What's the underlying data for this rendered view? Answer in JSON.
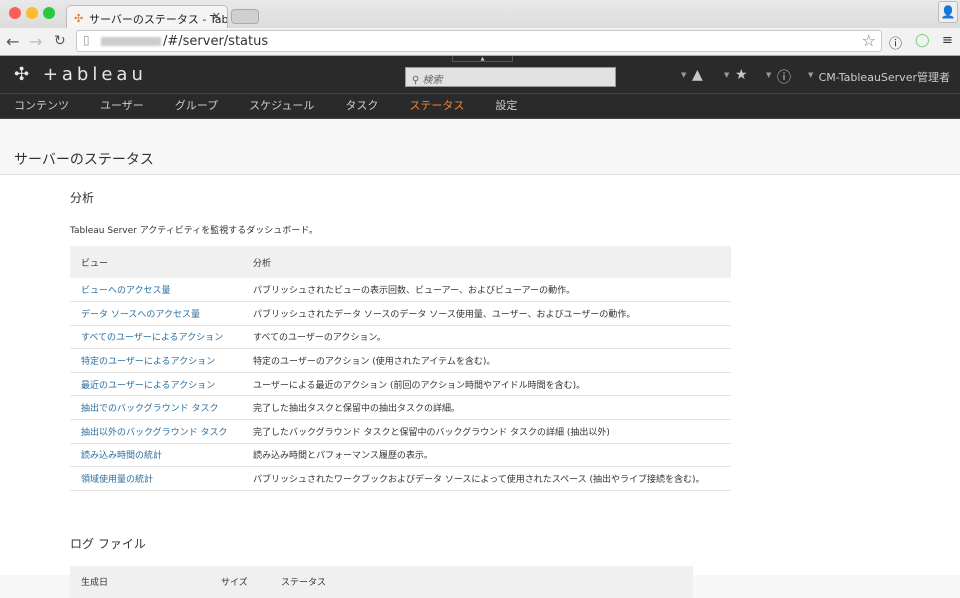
{
  "browser": {
    "tab_title": "サーバーのステータス - Tableau",
    "url_suffix": "/#/server/status"
  },
  "header": {
    "logo": "+ableau",
    "search_placeholder": "検索",
    "user": "CM-TableauServer管理者"
  },
  "nav": [
    "コンテンツ",
    "ユーザー",
    "グループ",
    "スケジュール",
    "タスク",
    "ステータス",
    "設定"
  ],
  "nav_active": 5,
  "page_title": "サーバーのステータス",
  "analysis": {
    "title": "分析",
    "description": "Tableau Server アクティビティを監視するダッシュボード。",
    "columns": [
      "ビュー",
      "分析"
    ],
    "rows": [
      [
        "ビューへのアクセス量",
        "パブリッシュされたビューの表示回数、ビューアー、およびビューアーの動作。"
      ],
      [
        "データ ソースへのアクセス量",
        "パブリッシュされたデータ ソースのデータ ソース使用量、ユーザー、およびユーザーの動作。"
      ],
      [
        "すべてのユーザーによるアクション",
        "すべてのユーザーのアクション。"
      ],
      [
        "特定のユーザーによるアクション",
        "特定のユーザーのアクション (使用されたアイテムを含む)。"
      ],
      [
        "最近のユーザーによるアクション",
        "ユーザーによる最近のアクション (前回のアクション時間やアイドル時間を含む)。"
      ],
      [
        "抽出でのバックグラウンド タスク",
        "完了した抽出タスクと保留中の抽出タスクの詳細。"
      ],
      [
        "抽出以外のバックグラウンド タスク",
        "完了したバックグラウンド タスクと保留中のバックグラウンド タスクの詳細 (抽出以外)"
      ],
      [
        "読み込み時間の統計",
        "読み込み時間とパフォーマンス履歴の表示。"
      ],
      [
        "領域使用量の統計",
        "パブリッシュされたワークブックおよびデータ ソースによって使用されたスペース (抽出やライブ接続を含む)。"
      ]
    ]
  },
  "logs": {
    "title": "ログ ファイル",
    "columns": [
      "生成日",
      "サイズ",
      "ステータス"
    ]
  }
}
